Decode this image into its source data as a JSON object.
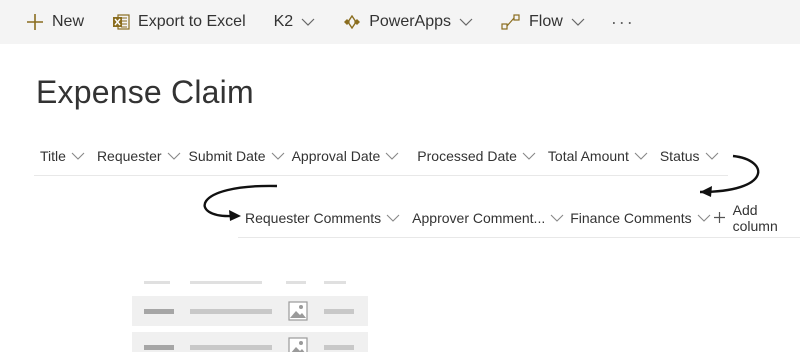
{
  "command_bar": {
    "new_label": "New",
    "export_label": "Export to Excel",
    "k2_label": "K2",
    "powerapps_label": "PowerApps",
    "flow_label": "Flow",
    "more_label": "···"
  },
  "page": {
    "title": "Expense Claim"
  },
  "columns_row1": [
    "Title",
    "Requester",
    "Submit Date",
    "Approval Date",
    "Processed Date",
    "Total Amount",
    "Status"
  ],
  "columns_row2": [
    "Requester Comments",
    "Approver Comment...",
    "Finance Comments"
  ],
  "add_column_label": "Add column",
  "colors": {
    "command_bar_bg": "#f4f4f4",
    "accent": "#8a6d1f",
    "text": "#333333",
    "divider": "#e8e8e8"
  },
  "icons": {
    "new": "plus-icon",
    "export": "excel-icon",
    "powerapps": "powerapps-icon",
    "flow": "flow-icon",
    "chevron": "chevron-down-icon"
  }
}
